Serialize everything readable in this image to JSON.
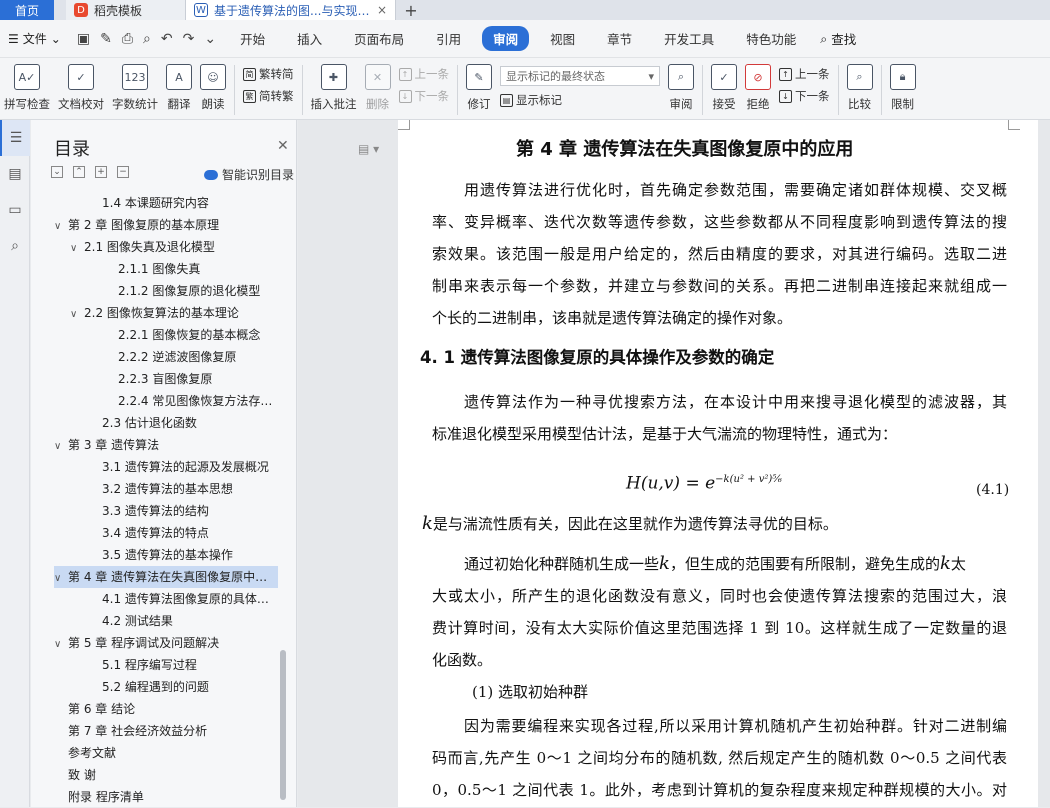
{
  "tabs": {
    "home": "首页",
    "t1": "稻壳模板",
    "t2": "基于遗传算法的图...与实现 毕业论文",
    "close": "×",
    "add": "+"
  },
  "menubar": {
    "file": "文件",
    "items": [
      "开始",
      "插入",
      "页面布局",
      "引用",
      "审阅",
      "视图",
      "章节",
      "开发工具",
      "特色功能"
    ],
    "active": "审阅",
    "search": "查找"
  },
  "ribbon": {
    "spell": "拼写检查",
    "proof": "文档校对",
    "count": "字数统计",
    "translate": "翻译",
    "read": "朗读",
    "trad": "繁转简",
    "simp": "简转繁",
    "insert_comment": "插入批注",
    "delete": "删除",
    "prev": "上一条",
    "next": "下一条",
    "revise": "修订",
    "markup_state": "显示标记的最终状态",
    "show_markup": "显示标记",
    "review": "审阅",
    "accept": "接受",
    "reject": "拒绝",
    "prev2": "上一条",
    "next2": "下一条",
    "compare": "比较",
    "restrict": "限制"
  },
  "toc": {
    "title": "目录",
    "smart": "智能识别目录",
    "items": [
      {
        "text": "1.4   本课题研究内容",
        "level": 2,
        "arrow": ""
      },
      {
        "text": "第 2 章  图像复原的基本原理",
        "level": 0,
        "arrow": "∨"
      },
      {
        "text": "2.1    图像失真及退化模型",
        "level": 1,
        "arrow": "∨"
      },
      {
        "text": "2.1.1  图像失真",
        "level": 3,
        "arrow": ""
      },
      {
        "text": "2.1.2  图像复原的退化模型",
        "level": 3,
        "arrow": ""
      },
      {
        "text": "2.2 图像恢复算法的基本理论",
        "level": 1,
        "arrow": "∨"
      },
      {
        "text": "2.2.1    图像恢复的基本概念",
        "level": 3,
        "arrow": ""
      },
      {
        "text": "2.2.2    逆滤波图像复原",
        "level": 3,
        "arrow": ""
      },
      {
        "text": "2.2.3    盲图像复原",
        "level": 3,
        "arrow": ""
      },
      {
        "text": "2.2.4 常见图像恢复方法存在的问题",
        "level": 3,
        "arrow": ""
      },
      {
        "text": "2.3    估计退化函数",
        "level": 2,
        "arrow": ""
      },
      {
        "text": "第 3 章  遗传算法",
        "level": 0,
        "arrow": "∨"
      },
      {
        "text": "3.1    遗传算法的起源及发展概况",
        "level": 2,
        "arrow": ""
      },
      {
        "text": "3.2    遗传算法的基本思想",
        "level": 2,
        "arrow": ""
      },
      {
        "text": "3.3    遗传算法的结构",
        "level": 2,
        "arrow": ""
      },
      {
        "text": "3.4 遗传算法的特点",
        "level": 2,
        "arrow": ""
      },
      {
        "text": "3.5 遗传算法的基本操作",
        "level": 2,
        "arrow": ""
      },
      {
        "text": "第 4 章  遗传算法在失真图像复原中的应用",
        "level": 0,
        "arrow": "∨",
        "selected": true
      },
      {
        "text": "4.1 遗传算法图像复原的具体操作及参数的确定",
        "level": 2,
        "arrow": ""
      },
      {
        "text": "4.2    测试结果",
        "level": 2,
        "arrow": ""
      },
      {
        "text": "第 5 章  程序调试及问题解决",
        "level": 0,
        "arrow": "∨"
      },
      {
        "text": "5.1  程序编写过程",
        "level": 2,
        "arrow": ""
      },
      {
        "text": "5.2  编程遇到的问题",
        "level": 2,
        "arrow": ""
      },
      {
        "text": "第 6 章  结论",
        "level": 0,
        "arrow": ""
      },
      {
        "text": "第 7 章  社会经济效益分析",
        "level": 0,
        "arrow": ""
      },
      {
        "text": "参考文献",
        "level": 0,
        "arrow": ""
      },
      {
        "text": "致    谢",
        "level": 0,
        "arrow": ""
      },
      {
        "text": "附录  程序清单",
        "level": 0,
        "arrow": ""
      }
    ]
  },
  "doc": {
    "chapter_title": "第 4 章  遗传算法在失真图像复原中的应用",
    "p1": [
      "用遗传算法进行优化时，首先确定参数范围，需要确定诸如群体规模、交叉概",
      "率、变异概率、迭代次数等遗传参数，这些参数都从不同程度影响到遗传算法的搜",
      "索效果。该范围一般是用户给定的，然后由精度的要求，对其进行编码。选取二进",
      "制串来表示每一个参数，并建立与参数间的关系。再把二进制串连接起来就组成一",
      "个长的二进制串，该串就是遗传算法确定的操作对象。"
    ],
    "section_title": "4. 1 遗传算法图像复原的具体操作及参数的确定",
    "p2": [
      "遗传算法作为一种寻优搜索方法，在本设计中用来搜寻退化模型的滤波器，其",
      "标准退化模型采用模型估计法，是基于大气湍流的物理特性，通式为："
    ],
    "equation": "H(u,v) = e",
    "equation_exp": "−k(u² + v²)⁵⁄₆",
    "equation_num": "(4.1)",
    "k": "k",
    "p3_rest": "是与湍流性质有关，因此在这里就作为遗传算法寻优的目标。",
    "p4_l1a": "通过初始化种群随机生成一些",
    "p4_l1b": "，但生成的范围要有所限制，避免生成的",
    "p4_l1c": "太",
    "p4": [
      "大或太小，所产生的退化函数没有意义，同时也会使遗传算法搜索的范围过大，浪",
      "费计算时间，没有太大实际价值这里范围选择 1 到 10。这样就生成了一定数量的退",
      "化函数。"
    ],
    "sub1": "(1)  选取初始种群",
    "p5": [
      "因为需要编程来实现各过程,所以采用计算机随机产生初始种群。针对二进制编",
      "码而言,先产生 0～1 之间均分布的随机数, 然后规定产生的随机数 0～0.5 之间代表",
      "0，0.5～1 之间代表 1。此外，考虑到计算机的复杂程度来规定种群规模的大小。对"
    ]
  }
}
